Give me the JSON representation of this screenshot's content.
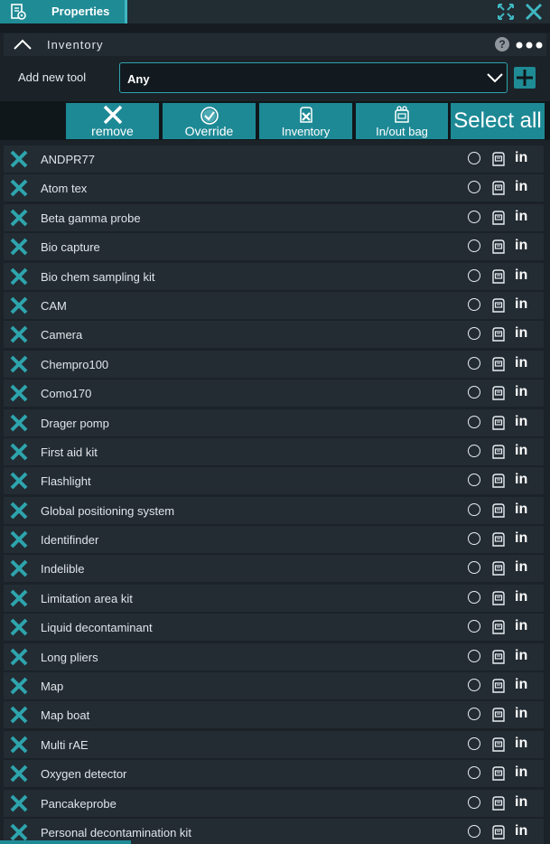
{
  "tab": {
    "label": "Properties"
  },
  "panel": {
    "title": "Inventory",
    "help": "?"
  },
  "add_tool": {
    "label": "Add new tool",
    "value": "Any"
  },
  "toolbar": {
    "remove": "remove",
    "override": "Override",
    "inventory": "Inventory",
    "inout": "In/out bag",
    "select_all": "Select all"
  },
  "colors": {
    "accent": "#1f8b95",
    "row_bg": "#232c33",
    "background": "#1b2228"
  },
  "items": [
    {
      "name": "ANDPR77",
      "state": "in"
    },
    {
      "name": "Atom tex",
      "state": "in"
    },
    {
      "name": "Beta gamma probe",
      "state": "in"
    },
    {
      "name": "Bio capture",
      "state": "in"
    },
    {
      "name": "Bio chem sampling kit",
      "state": "in"
    },
    {
      "name": "CAM",
      "state": "in"
    },
    {
      "name": "Camera",
      "state": "in"
    },
    {
      "name": "Chempro100",
      "state": "in"
    },
    {
      "name": "Como170",
      "state": "in"
    },
    {
      "name": "Drager pomp",
      "state": "in"
    },
    {
      "name": "First aid kit",
      "state": "in"
    },
    {
      "name": "Flashlight",
      "state": "in"
    },
    {
      "name": "Global positioning system",
      "state": "in"
    },
    {
      "name": "Identifinder",
      "state": "in"
    },
    {
      "name": "Indelible",
      "state": "in"
    },
    {
      "name": "Limitation area kit",
      "state": "in"
    },
    {
      "name": "Liquid decontaminant",
      "state": "in"
    },
    {
      "name": "Long pliers",
      "state": "in"
    },
    {
      "name": "Map",
      "state": "in"
    },
    {
      "name": "Map boat",
      "state": "in"
    },
    {
      "name": "Multi rAE",
      "state": "in"
    },
    {
      "name": "Oxygen detector",
      "state": "in"
    },
    {
      "name": "Pancakeprobe",
      "state": "in"
    },
    {
      "name": "Personal decontamination kit",
      "state": "in"
    }
  ]
}
